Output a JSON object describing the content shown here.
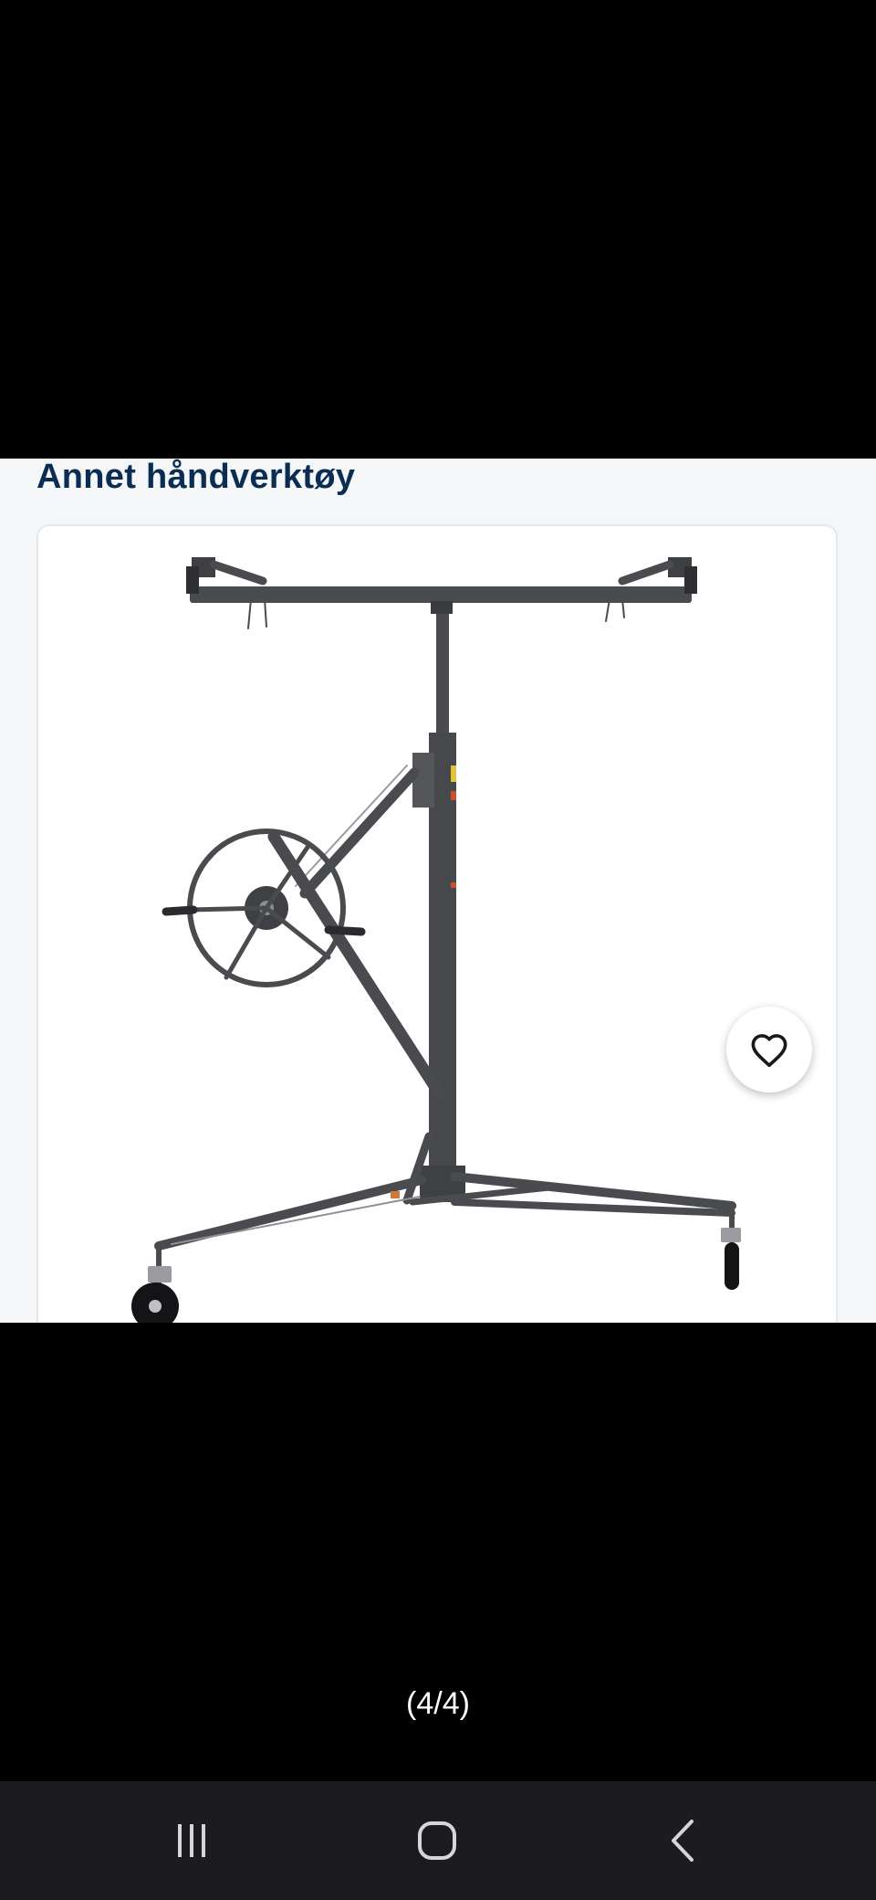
{
  "listing": {
    "category": "Annet håndverktøy"
  },
  "gallery": {
    "counter": "(4/4)",
    "image_subject": "drywall-panel-lift"
  },
  "favorite": {
    "icon": "heart-outline-icon"
  },
  "system_nav": {
    "recents_icon": "recents-icon",
    "home_icon": "home-icon",
    "back_icon": "back-icon"
  },
  "colors": {
    "title_text": "#0b2d52",
    "page_bg": "#f4f6f8",
    "card_bg": "#ffffff",
    "lift_metal": "#4a4b4f",
    "nav_bar_bg": "#1c1b20",
    "nav_icon": "#d6d6da"
  }
}
